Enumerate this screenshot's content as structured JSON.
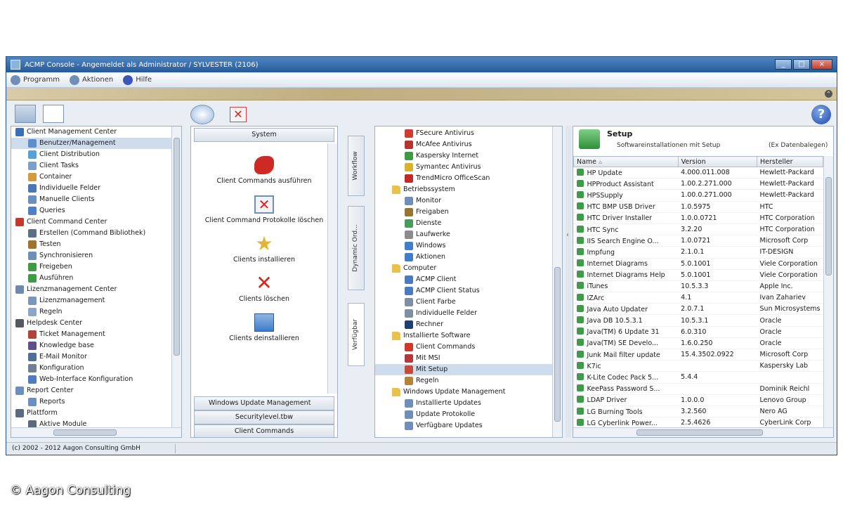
{
  "window": {
    "title": "ACMP Console - Angemeldet als Administrator / SYLVESTER (2106)"
  },
  "menubar": [
    {
      "label": "Programm",
      "icon": "program-icon"
    },
    {
      "label": "Aktionen",
      "icon": "actions-icon"
    },
    {
      "label": "Hilfe",
      "icon": "help-icon"
    }
  ],
  "left_tree": [
    {
      "label": "Client Management Center",
      "level": 0,
      "color": "#3a6fb5"
    },
    {
      "label": "Benutzer/Management",
      "level": 1,
      "color": "#5c8fd1",
      "selected": true
    },
    {
      "label": "Client Distribution",
      "level": 1,
      "color": "#5aa0d8"
    },
    {
      "label": "Client Tasks",
      "level": 1,
      "color": "#7a9fc9"
    },
    {
      "label": "Container",
      "level": 1,
      "color": "#d59a3c"
    },
    {
      "label": "Individuelle Felder",
      "level": 1,
      "color": "#4a78b5"
    },
    {
      "label": "Manuelle Clients",
      "level": 1,
      "color": "#6a8fc0"
    },
    {
      "label": "Queries",
      "level": 1,
      "color": "#4f7fc4"
    },
    {
      "label": "Client Command Center",
      "level": 0,
      "color": "#c23a2e"
    },
    {
      "label": "Erstellen (Command Bibliothek)",
      "level": 1,
      "color": "#5d6f86"
    },
    {
      "label": "Testen",
      "level": 1,
      "color": "#a0742f"
    },
    {
      "label": "Synchronisieren",
      "level": 1,
      "color": "#6f8fb8"
    },
    {
      "label": "Freigeben",
      "level": 1,
      "color": "#3e9a44"
    },
    {
      "label": "Ausführen",
      "level": 1,
      "color": "#3e9a44"
    },
    {
      "label": "Lizenzmanagement Center",
      "level": 0,
      "color": "#6c89b0"
    },
    {
      "label": "Lizenzmanagement",
      "level": 1,
      "color": "#7b96bc"
    },
    {
      "label": "Regeln",
      "level": 1,
      "color": "#8ca6c7"
    },
    {
      "label": "Helpdesk Center",
      "level": 0,
      "color": "#55585e"
    },
    {
      "label": "Ticket Management",
      "level": 1,
      "color": "#b0443a"
    },
    {
      "label": "Knowledge base",
      "level": 1,
      "color": "#5f4f8a"
    },
    {
      "label": "E-Mail Monitor",
      "level": 1,
      "color": "#4f6f9a"
    },
    {
      "label": "Konfiguration",
      "level": 1,
      "color": "#6f7f95"
    },
    {
      "label": "Web-Interface Konfiguration",
      "level": 1,
      "color": "#4e7cc0"
    },
    {
      "label": "Report Center",
      "level": 0,
      "color": "#6a8fc0"
    },
    {
      "label": "Reports",
      "level": 1,
      "color": "#6a8fc0"
    },
    {
      "label": "Plattform",
      "level": 0,
      "color": "#5a6a80"
    },
    {
      "label": "Aktive Module",
      "level": 1,
      "color": "#5a6a80"
    }
  ],
  "middle": {
    "header": "System",
    "actions": [
      {
        "label": "Client Commands ausführen",
        "icon": "puzzle-icon",
        "color": "#cc2a22"
      },
      {
        "label": "Client Command Protokolle löschen",
        "icon": "delete-log-icon",
        "color": "#d24a3a"
      },
      {
        "label": "Clients installieren",
        "icon": "star-install-icon",
        "color": "#e2b634"
      },
      {
        "label": "Clients löschen",
        "icon": "delete-x-icon",
        "color": "#d9281f"
      },
      {
        "label": "Clients deinstallieren",
        "icon": "uninstall-icon",
        "color": "#3e7cc9"
      }
    ],
    "bottom_sections": [
      {
        "label": "Windows Update Management"
      },
      {
        "label": "Securitylevel.tbw"
      },
      {
        "label": "Client Commands"
      }
    ]
  },
  "vertical_tabs": [
    {
      "label": "Workflow"
    },
    {
      "label": "Dynamic Ord..."
    },
    {
      "label": "Verfügbar"
    }
  ],
  "right_tree": [
    {
      "label": "FSecure Antivirus",
      "level": 2,
      "color": "#d13b2e"
    },
    {
      "label": "McAfee Antivirus",
      "level": 2,
      "color": "#b8332d"
    },
    {
      "label": "Kaspersky Internet",
      "level": 2,
      "color": "#3f9a44"
    },
    {
      "label": "Symantec Antivirus",
      "level": 2,
      "color": "#d9b229"
    },
    {
      "label": "TrendMicro OfficeScan",
      "level": 2,
      "color": "#c12a24"
    },
    {
      "label": "Betriebssystem",
      "level": 1,
      "color": "#e8c24a",
      "folder": true
    },
    {
      "label": "Monitor",
      "level": 2,
      "color": "#6f8fb8"
    },
    {
      "label": "Freigaben",
      "level": 2,
      "color": "#9a7432"
    },
    {
      "label": "Dienste",
      "level": 2,
      "color": "#4a9a5e"
    },
    {
      "label": "Laufwerke",
      "level": 2,
      "color": "#8c8c8c"
    },
    {
      "label": "Windows",
      "level": 2,
      "color": "#3f7fc8"
    },
    {
      "label": "Aktionen",
      "level": 2,
      "color": "#3f7fc8"
    },
    {
      "label": "Computer",
      "level": 1,
      "color": "#e8c24a",
      "folder": true
    },
    {
      "label": "ACMP Client",
      "level": 2,
      "color": "#4a7bc0"
    },
    {
      "label": "ACMP Client Status",
      "level": 2,
      "color": "#4a7bc0"
    },
    {
      "label": "Client Farbe",
      "level": 2,
      "color": "#7f8fa3"
    },
    {
      "label": "Individuelle Felder",
      "level": 2,
      "color": "#7f8fa3"
    },
    {
      "label": "Rechner",
      "level": 2,
      "color": "#1f3f6f"
    },
    {
      "label": "Installierte Software",
      "level": 1,
      "color": "#e8c24a",
      "folder": true
    },
    {
      "label": "Client Commands",
      "level": 2,
      "color": "#cc3a2a"
    },
    {
      "label": "Mit MSI",
      "level": 2,
      "color": "#b33a3a"
    },
    {
      "label": "Mit Setup",
      "level": 2,
      "color": "#c44a3a",
      "selected": true
    },
    {
      "label": "Regeln",
      "level": 2,
      "color": "#b3843a"
    },
    {
      "label": "Windows Update Management",
      "level": 1,
      "color": "#e8c24a",
      "folder": true
    },
    {
      "label": "Installierte Updates",
      "level": 2,
      "color": "#6f8fb8"
    },
    {
      "label": "Update Protokolle",
      "level": 2,
      "color": "#6f8fb8"
    },
    {
      "label": "Verfügbare Updates",
      "level": 2,
      "color": "#6f8fb8"
    }
  ],
  "detail": {
    "title": "Setup",
    "subtitle": "Softwareinstallationen mit Setup",
    "subtitle_right": "(Ex Datenbalegen)",
    "columns": [
      "Name",
      "Version",
      "Hersteller"
    ],
    "rows": [
      [
        "HP Update",
        "4.000.011.008",
        "Hewlett-Packard"
      ],
      [
        "HPProduct Assistant",
        "1.00.2.271.000",
        "Hewlett-Packard"
      ],
      [
        "HPSSupply",
        "1.00.0.271.000",
        "Hewlett-Packard"
      ],
      [
        "HTC BMP USB Driver",
        "1.0.5975",
        "HTC"
      ],
      [
        "HTC Driver Installer",
        "1.0.0.0721",
        "HTC Corporation"
      ],
      [
        "HTC Sync",
        "3.2.20",
        "HTC Corporation"
      ],
      [
        "IIS Search Engine O...",
        "1.0.0721",
        "Microsoft Corp"
      ],
      [
        "Impfung",
        "2.1.0.1",
        "IT-DESIGN"
      ],
      [
        "Internet Diagrams",
        "5.0.1001",
        "Viele Corporation"
      ],
      [
        "Internet Diagrams Help",
        "5.0.1001",
        "Viele Corporation"
      ],
      [
        "iTunes",
        "10.5.3.3",
        "Apple Inc."
      ],
      [
        "IZArc",
        "4.1",
        "Ivan Zahariev"
      ],
      [
        "Java Auto Updater",
        "2.0.7.1",
        "Sun Microsystems"
      ],
      [
        "Java DB 10.5.3.1",
        "10.5.3.1",
        "Oracle"
      ],
      [
        "Java(TM) 6 Update 31",
        "6.0.310",
        "Oracle"
      ],
      [
        "Java(TM) SE Develo...",
        "1.6.0.250",
        "Oracle"
      ],
      [
        "Junk Mail filter update",
        "15.4.3502.0922",
        "Microsoft Corp"
      ],
      [
        "K7ic",
        "",
        "Kaspersky Lab"
      ],
      [
        "K-Lite Codec Pack 5...",
        "5.4.4",
        ""
      ],
      [
        "KeePass Password S...",
        "",
        "Dominik Reichl"
      ],
      [
        "LDAP Driver",
        "1.0.0.0",
        "Lenovo Group"
      ],
      [
        "LG Burning Tools",
        "3.2.560",
        "Nero AG"
      ],
      [
        "LG Cyberlink Power...",
        "2.5.4626",
        "CyberLink Corp"
      ]
    ]
  },
  "statusbar": {
    "text": "(c) 2002 - 2012 Aagon Consulting GmbH"
  },
  "watermark": "© Aagon Consulting"
}
